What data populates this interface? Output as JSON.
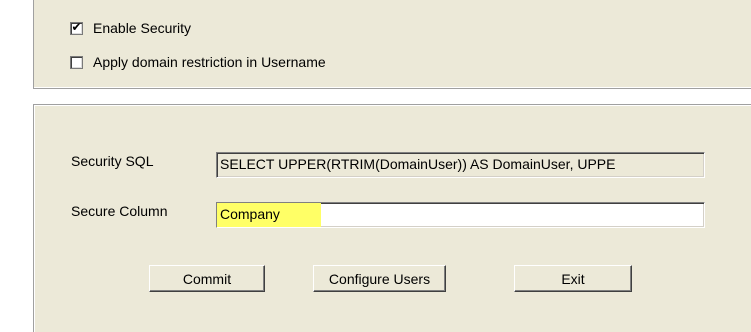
{
  "security_options": {
    "enable_security": {
      "label": "Enable Security",
      "checked": true,
      "check_glyph": "✔"
    },
    "domain_restriction": {
      "label": "Apply domain restriction in Username",
      "checked": false,
      "check_glyph": ""
    }
  },
  "form": {
    "security_sql": {
      "label": "Security SQL",
      "value": "SELECT UPPER(RTRIM(DomainUser)) AS DomainUser, UPPE"
    },
    "secure_column": {
      "label": "Secure Column",
      "value": "Company",
      "highlight_color": "#ffff66"
    }
  },
  "buttons": {
    "commit": "Commit",
    "configure_users": "Configure Users",
    "exit": "Exit"
  },
  "colors": {
    "panel_background": "#ece9d8",
    "window_background": "#ffffff"
  }
}
